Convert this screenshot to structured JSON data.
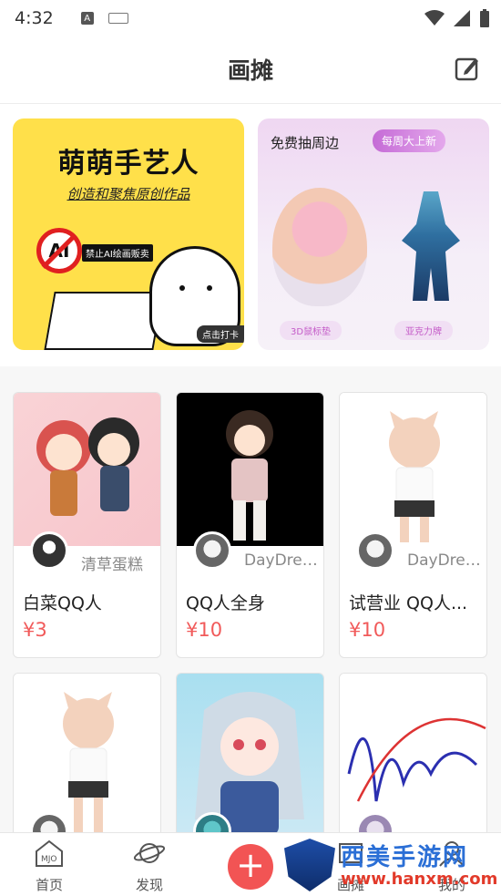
{
  "status_bar": {
    "time": "4:32",
    "a_badge": "A"
  },
  "header": {
    "title": "画摊"
  },
  "banners": {
    "left": {
      "title": "萌萌手艺人",
      "subtitle": "创造和聚焦原创作品",
      "ai_text": "AI",
      "ban_text": "禁止AI绘画贩卖",
      "click_text": "点击打卡"
    },
    "right": {
      "title": "免费抽周边",
      "tag": "每周大上新",
      "label1": "3D鼠标垫",
      "label2": "亚克力牌"
    }
  },
  "items": [
    {
      "author": "清草蛋糕",
      "name": "白菜QQ人",
      "price": "¥3"
    },
    {
      "author": "DayDrea...",
      "name": "QQ人全身",
      "price": "¥10"
    },
    {
      "author": "DayDrea...",
      "name": "试营业  QQ人...",
      "price": "¥10"
    },
    {
      "author": "",
      "name": "",
      "price": ""
    },
    {
      "author": "",
      "name": "",
      "price": ""
    },
    {
      "author": "",
      "name": "",
      "price": ""
    }
  ],
  "bottom_nav": {
    "home": "首页",
    "discover": "发现",
    "fab": "+",
    "stall": "画摊",
    "mine": "我的"
  },
  "watermark": {
    "title": "西美手游网",
    "url": "www.hanxm.com"
  },
  "colors": {
    "accent": "#f25454",
    "price": "#f15a5a",
    "banner_yellow": "#ffe04a"
  }
}
